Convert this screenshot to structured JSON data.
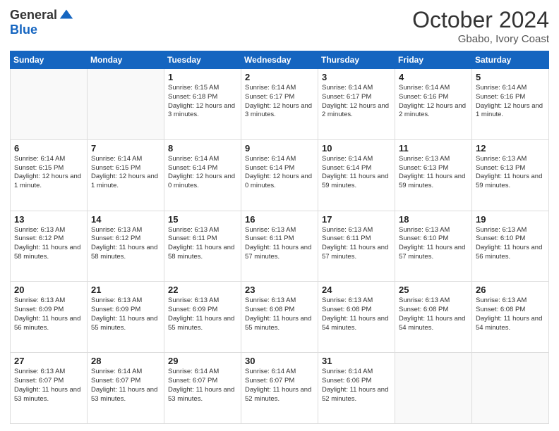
{
  "logo": {
    "general": "General",
    "blue": "Blue"
  },
  "header": {
    "month": "October 2024",
    "location": "Gbabo, Ivory Coast"
  },
  "weekdays": [
    "Sunday",
    "Monday",
    "Tuesday",
    "Wednesday",
    "Thursday",
    "Friday",
    "Saturday"
  ],
  "weeks": [
    [
      {
        "day": "",
        "sunrise": "",
        "sunset": "",
        "daylight": ""
      },
      {
        "day": "",
        "sunrise": "",
        "sunset": "",
        "daylight": ""
      },
      {
        "day": "1",
        "sunrise": "Sunrise: 6:15 AM",
        "sunset": "Sunset: 6:18 PM",
        "daylight": "Daylight: 12 hours and 3 minutes."
      },
      {
        "day": "2",
        "sunrise": "Sunrise: 6:14 AM",
        "sunset": "Sunset: 6:17 PM",
        "daylight": "Daylight: 12 hours and 3 minutes."
      },
      {
        "day": "3",
        "sunrise": "Sunrise: 6:14 AM",
        "sunset": "Sunset: 6:17 PM",
        "daylight": "Daylight: 12 hours and 2 minutes."
      },
      {
        "day": "4",
        "sunrise": "Sunrise: 6:14 AM",
        "sunset": "Sunset: 6:16 PM",
        "daylight": "Daylight: 12 hours and 2 minutes."
      },
      {
        "day": "5",
        "sunrise": "Sunrise: 6:14 AM",
        "sunset": "Sunset: 6:16 PM",
        "daylight": "Daylight: 12 hours and 1 minute."
      }
    ],
    [
      {
        "day": "6",
        "sunrise": "Sunrise: 6:14 AM",
        "sunset": "Sunset: 6:15 PM",
        "daylight": "Daylight: 12 hours and 1 minute."
      },
      {
        "day": "7",
        "sunrise": "Sunrise: 6:14 AM",
        "sunset": "Sunset: 6:15 PM",
        "daylight": "Daylight: 12 hours and 1 minute."
      },
      {
        "day": "8",
        "sunrise": "Sunrise: 6:14 AM",
        "sunset": "Sunset: 6:14 PM",
        "daylight": "Daylight: 12 hours and 0 minutes."
      },
      {
        "day": "9",
        "sunrise": "Sunrise: 6:14 AM",
        "sunset": "Sunset: 6:14 PM",
        "daylight": "Daylight: 12 hours and 0 minutes."
      },
      {
        "day": "10",
        "sunrise": "Sunrise: 6:14 AM",
        "sunset": "Sunset: 6:14 PM",
        "daylight": "Daylight: 11 hours and 59 minutes."
      },
      {
        "day": "11",
        "sunrise": "Sunrise: 6:13 AM",
        "sunset": "Sunset: 6:13 PM",
        "daylight": "Daylight: 11 hours and 59 minutes."
      },
      {
        "day": "12",
        "sunrise": "Sunrise: 6:13 AM",
        "sunset": "Sunset: 6:13 PM",
        "daylight": "Daylight: 11 hours and 59 minutes."
      }
    ],
    [
      {
        "day": "13",
        "sunrise": "Sunrise: 6:13 AM",
        "sunset": "Sunset: 6:12 PM",
        "daylight": "Daylight: 11 hours and 58 minutes."
      },
      {
        "day": "14",
        "sunrise": "Sunrise: 6:13 AM",
        "sunset": "Sunset: 6:12 PM",
        "daylight": "Daylight: 11 hours and 58 minutes."
      },
      {
        "day": "15",
        "sunrise": "Sunrise: 6:13 AM",
        "sunset": "Sunset: 6:11 PM",
        "daylight": "Daylight: 11 hours and 58 minutes."
      },
      {
        "day": "16",
        "sunrise": "Sunrise: 6:13 AM",
        "sunset": "Sunset: 6:11 PM",
        "daylight": "Daylight: 11 hours and 57 minutes."
      },
      {
        "day": "17",
        "sunrise": "Sunrise: 6:13 AM",
        "sunset": "Sunset: 6:11 PM",
        "daylight": "Daylight: 11 hours and 57 minutes."
      },
      {
        "day": "18",
        "sunrise": "Sunrise: 6:13 AM",
        "sunset": "Sunset: 6:10 PM",
        "daylight": "Daylight: 11 hours and 57 minutes."
      },
      {
        "day": "19",
        "sunrise": "Sunrise: 6:13 AM",
        "sunset": "Sunset: 6:10 PM",
        "daylight": "Daylight: 11 hours and 56 minutes."
      }
    ],
    [
      {
        "day": "20",
        "sunrise": "Sunrise: 6:13 AM",
        "sunset": "Sunset: 6:09 PM",
        "daylight": "Daylight: 11 hours and 56 minutes."
      },
      {
        "day": "21",
        "sunrise": "Sunrise: 6:13 AM",
        "sunset": "Sunset: 6:09 PM",
        "daylight": "Daylight: 11 hours and 55 minutes."
      },
      {
        "day": "22",
        "sunrise": "Sunrise: 6:13 AM",
        "sunset": "Sunset: 6:09 PM",
        "daylight": "Daylight: 11 hours and 55 minutes."
      },
      {
        "day": "23",
        "sunrise": "Sunrise: 6:13 AM",
        "sunset": "Sunset: 6:08 PM",
        "daylight": "Daylight: 11 hours and 55 minutes."
      },
      {
        "day": "24",
        "sunrise": "Sunrise: 6:13 AM",
        "sunset": "Sunset: 6:08 PM",
        "daylight": "Daylight: 11 hours and 54 minutes."
      },
      {
        "day": "25",
        "sunrise": "Sunrise: 6:13 AM",
        "sunset": "Sunset: 6:08 PM",
        "daylight": "Daylight: 11 hours and 54 minutes."
      },
      {
        "day": "26",
        "sunrise": "Sunrise: 6:13 AM",
        "sunset": "Sunset: 6:08 PM",
        "daylight": "Daylight: 11 hours and 54 minutes."
      }
    ],
    [
      {
        "day": "27",
        "sunrise": "Sunrise: 6:13 AM",
        "sunset": "Sunset: 6:07 PM",
        "daylight": "Daylight: 11 hours and 53 minutes."
      },
      {
        "day": "28",
        "sunrise": "Sunrise: 6:14 AM",
        "sunset": "Sunset: 6:07 PM",
        "daylight": "Daylight: 11 hours and 53 minutes."
      },
      {
        "day": "29",
        "sunrise": "Sunrise: 6:14 AM",
        "sunset": "Sunset: 6:07 PM",
        "daylight": "Daylight: 11 hours and 53 minutes."
      },
      {
        "day": "30",
        "sunrise": "Sunrise: 6:14 AM",
        "sunset": "Sunset: 6:07 PM",
        "daylight": "Daylight: 11 hours and 52 minutes."
      },
      {
        "day": "31",
        "sunrise": "Sunrise: 6:14 AM",
        "sunset": "Sunset: 6:06 PM",
        "daylight": "Daylight: 11 hours and 52 minutes."
      },
      {
        "day": "",
        "sunrise": "",
        "sunset": "",
        "daylight": ""
      },
      {
        "day": "",
        "sunrise": "",
        "sunset": "",
        "daylight": ""
      }
    ]
  ]
}
